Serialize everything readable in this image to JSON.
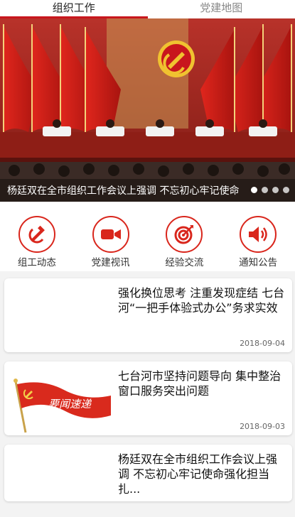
{
  "tabs": [
    {
      "label": "组织工作",
      "active": true
    },
    {
      "label": "党建地图",
      "active": false
    }
  ],
  "banner": {
    "caption": "杨廷双在全市组织工作会议上强调  不忘初心牢记使命",
    "slide_count": 4,
    "active_slide": 0
  },
  "quick_links": [
    {
      "label": "组工动态",
      "icon": "hammer-sickle-icon"
    },
    {
      "label": "党建视讯",
      "icon": "video-camera-icon"
    },
    {
      "label": "经验交流",
      "icon": "target-icon"
    },
    {
      "label": "通知公告",
      "icon": "speaker-icon"
    }
  ],
  "news": [
    {
      "title": "强化换位思考 注重发现症结 七台河“一把手体验式办公”务求实效",
      "date": "2018-09-04",
      "thumb": "blank"
    },
    {
      "title": "七台河市坚持问题导向 集中整治窗口服务突出问题",
      "date": "2018-09-03",
      "thumb": "flag",
      "thumb_text": "要闻速递"
    },
    {
      "title": "杨廷双在全市组织工作会议上强调  不忘初心牢记使命强化担当扎...",
      "date": "",
      "thumb": "blank"
    }
  ],
  "colors": {
    "accent": "#c8161d",
    "icon_red": "#d9261c"
  }
}
